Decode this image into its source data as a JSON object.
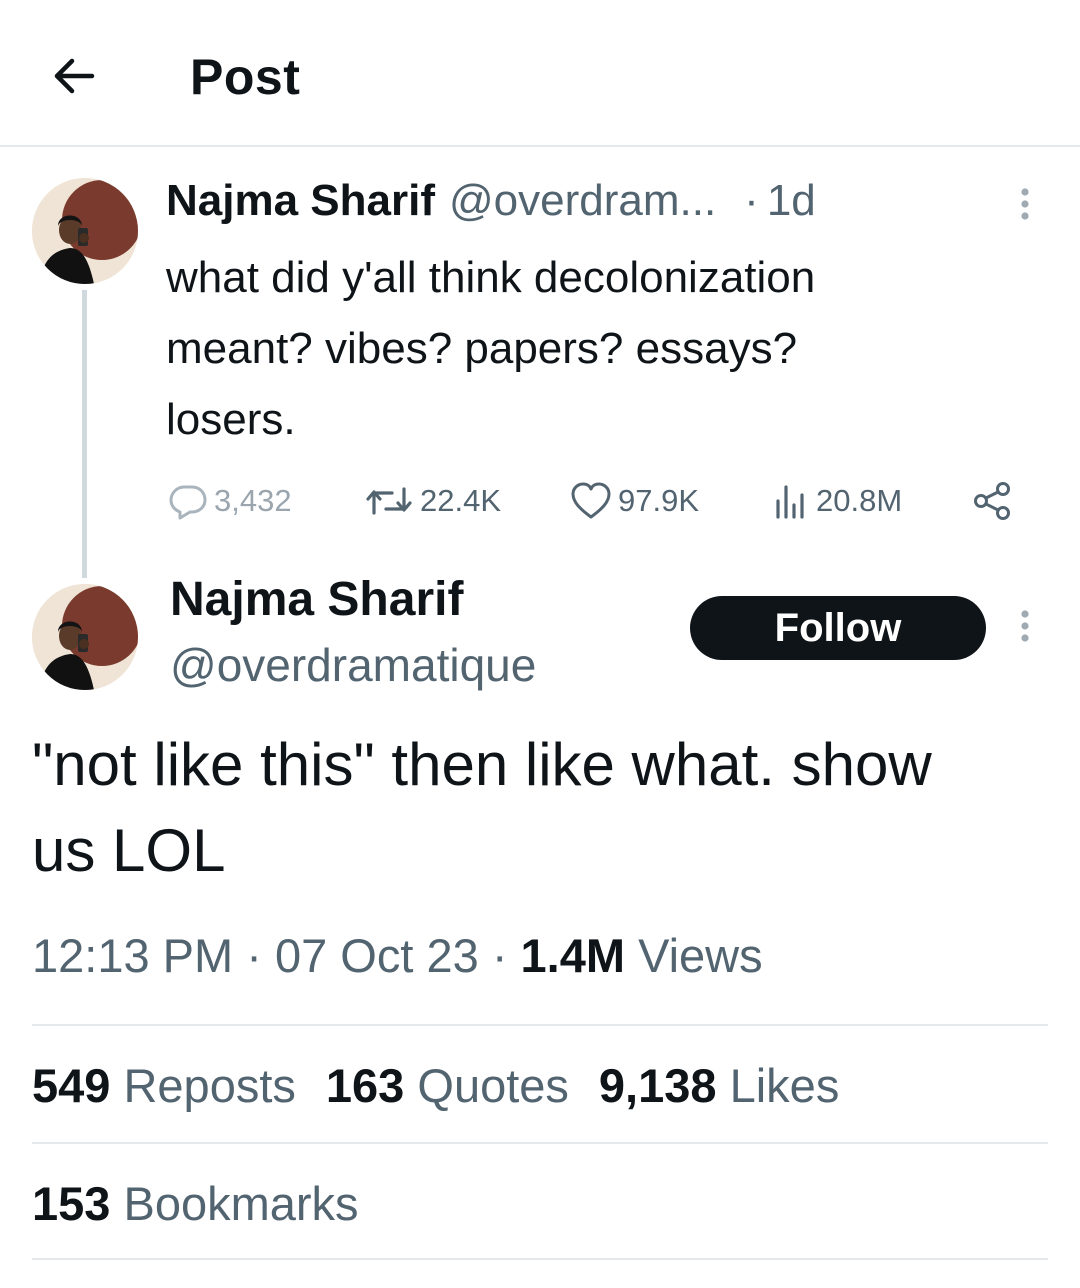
{
  "header": {
    "title": "Post"
  },
  "parent_post": {
    "author_name": "Najma Sharif",
    "author_handle": "@overdram...",
    "separator": "·",
    "time": "1d",
    "text_lines": [
      "what did y'all think decolonization",
      "meant? vibes? papers? essays?",
      "losers."
    ],
    "actions": {
      "replies": "3,432",
      "reposts": "22.4K",
      "likes": "97.9K",
      "views": "20.8M"
    }
  },
  "main_post": {
    "author_name": "Najma Sharif",
    "author_handle": "@overdramatique",
    "follow_label": "Follow",
    "text_lines": [
      "\"not like this\" then like what. show",
      "us LOL"
    ],
    "meta": {
      "time": "12:13 PM",
      "sep1": " · ",
      "date": "07 Oct 23",
      "sep2": " · ",
      "views_count": "1.4M",
      "views_label": " Views"
    },
    "stats": {
      "reposts_count": "549",
      "reposts_label": " Reposts",
      "quotes_count": "163",
      "quotes_label": " Quotes",
      "likes_count": "9,138",
      "likes_label": " Likes",
      "bookmarks_count": "153",
      "bookmarks_label": " Bookmarks"
    }
  },
  "colors": {
    "text_primary": "#0f1419",
    "text_secondary": "#536471",
    "divider": "#e6e9eb",
    "follow_bg": "#0f1419"
  },
  "icons": [
    "back-arrow-icon",
    "more-icon",
    "reply-icon",
    "repost-icon",
    "like-icon",
    "views-icon",
    "share-icon"
  ]
}
